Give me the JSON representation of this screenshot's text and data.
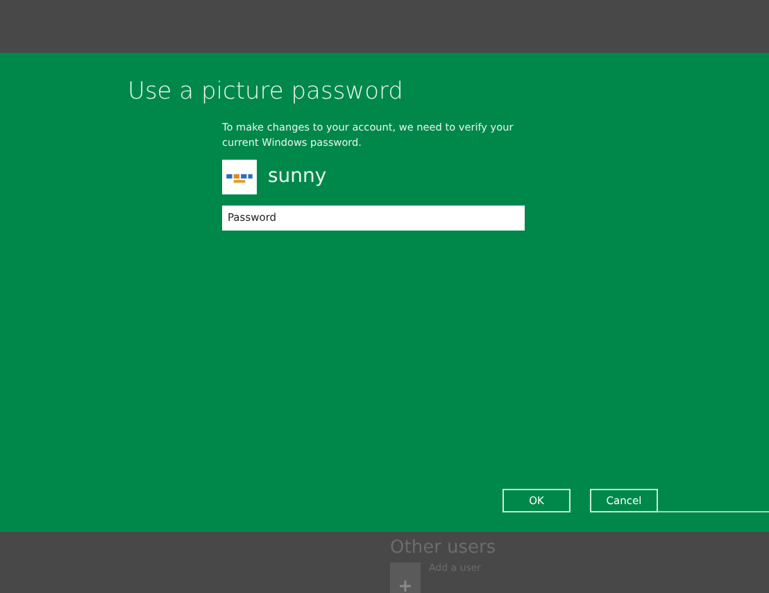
{
  "dialog": {
    "title": "Use a picture password",
    "message": "To make changes to your account, we need to verify your current Windows password.",
    "user": {
      "name": "sunny"
    },
    "password": {
      "placeholder": "Password"
    },
    "buttons": [
      "OK",
      "Cancel"
    ]
  },
  "other_users": {
    "heading": "Other users",
    "add_user": "Add a user"
  }
}
